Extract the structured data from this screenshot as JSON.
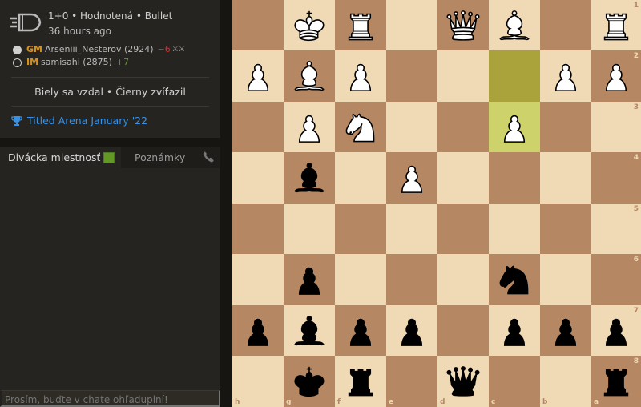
{
  "game": {
    "speed_line": "1+0 • Hodnotená • Bullet",
    "time_ago": "36 hours ago",
    "white": {
      "title": "GM",
      "name": "Arseniii_Nesterov (2924)",
      "diff": "−6",
      "badge": "⚔⚔"
    },
    "black": {
      "title": "IM",
      "name": "samisahi (2875)",
      "diff": "+7"
    },
    "result": "Biely sa vzdal • Čierny zvíťazil",
    "tournament": "Titled Arena January '22"
  },
  "chat": {
    "tab_chat": "Divácka miestnosť",
    "tab_notes": "Poznámky",
    "placeholder": "Prosím, buďte v chate ohľaduplní!",
    "chat_enabled": true
  },
  "colors": {
    "light_square": "#f0d9b5",
    "dark_square": "#b58863",
    "highlight_light": "#cdd26a",
    "highlight_dark": "#aaa23a",
    "link": "#3692e7",
    "title": "#d59120"
  },
  "board": {
    "orientation": "black",
    "files_label": [
      "h",
      "g",
      "f",
      "e",
      "d",
      "c",
      "b",
      "a"
    ],
    "ranks_label": [
      "1",
      "2",
      "3",
      "4",
      "5",
      "6",
      "7",
      "8"
    ],
    "highlight": [
      "c2",
      "c3"
    ],
    "pieces": [
      {
        "sq": "g1",
        "p": "wK"
      },
      {
        "sq": "f1",
        "p": "wR"
      },
      {
        "sq": "d1",
        "p": "wQ"
      },
      {
        "sq": "c1",
        "p": "wB"
      },
      {
        "sq": "a1",
        "p": "wR"
      },
      {
        "sq": "h2",
        "p": "wP"
      },
      {
        "sq": "g2",
        "p": "wB"
      },
      {
        "sq": "f2",
        "p": "wP"
      },
      {
        "sq": "b2",
        "p": "wP"
      },
      {
        "sq": "a2",
        "p": "wP"
      },
      {
        "sq": "g3",
        "p": "wP"
      },
      {
        "sq": "f3",
        "p": "wN"
      },
      {
        "sq": "c3",
        "p": "wP"
      },
      {
        "sq": "g4",
        "p": "bB"
      },
      {
        "sq": "e4",
        "p": "wP"
      },
      {
        "sq": "g6",
        "p": "bP"
      },
      {
        "sq": "c6",
        "p": "bN"
      },
      {
        "sq": "h7",
        "p": "bP"
      },
      {
        "sq": "g7",
        "p": "bB"
      },
      {
        "sq": "f7",
        "p": "bP"
      },
      {
        "sq": "e7",
        "p": "bP"
      },
      {
        "sq": "c7",
        "p": "bP"
      },
      {
        "sq": "b7",
        "p": "bP"
      },
      {
        "sq": "a7",
        "p": "bP"
      },
      {
        "sq": "g8",
        "p": "bK"
      },
      {
        "sq": "f8",
        "p": "bR"
      },
      {
        "sq": "d8",
        "p": "bQ"
      },
      {
        "sq": "a8",
        "p": "bR"
      }
    ]
  }
}
